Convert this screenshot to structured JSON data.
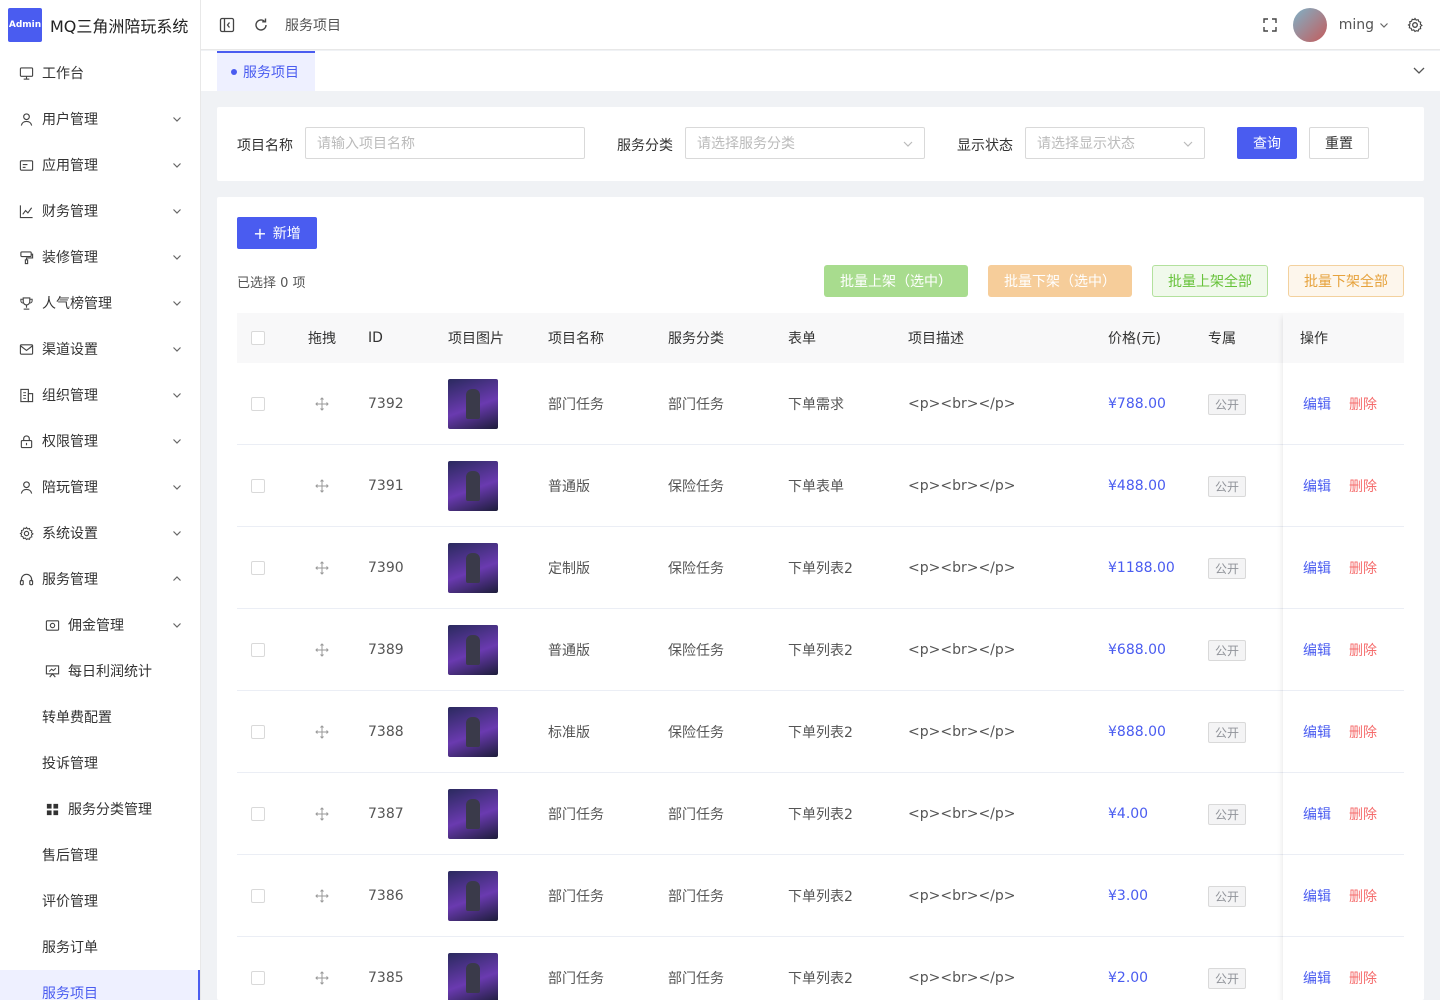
{
  "brand": {
    "logo_text": "Admin",
    "title": "MQ三角洲陪玩系统"
  },
  "sidebar": {
    "items": [
      {
        "label": "工作台",
        "icon": "monitor-icon",
        "arrow": ""
      },
      {
        "label": "用户管理",
        "icon": "user-icon",
        "arrow": "down"
      },
      {
        "label": "应用管理",
        "icon": "app-icon",
        "arrow": "down"
      },
      {
        "label": "财务管理",
        "icon": "chart-icon",
        "arrow": "down"
      },
      {
        "label": "装修管理",
        "icon": "paint-icon",
        "arrow": "down"
      },
      {
        "label": "人气榜管理",
        "icon": "trophy-icon",
        "arrow": "down"
      },
      {
        "label": "渠道设置",
        "icon": "mail-icon",
        "arrow": "down"
      },
      {
        "label": "组织管理",
        "icon": "building-icon",
        "arrow": "down"
      },
      {
        "label": "权限管理",
        "icon": "lock-icon",
        "arrow": "down"
      },
      {
        "label": "陪玩管理",
        "icon": "person-icon",
        "arrow": "down"
      },
      {
        "label": "系统设置",
        "icon": "gear-icon",
        "arrow": "down"
      },
      {
        "label": "服务管理",
        "icon": "headset-icon",
        "arrow": "up"
      }
    ],
    "sub_items": [
      {
        "label": "佣金管理",
        "icon": "wallet-icon",
        "arrow": "down"
      },
      {
        "label": "每日利润统计",
        "icon": "presentation-icon",
        "arrow": ""
      },
      {
        "label": "转单费配置",
        "icon": "",
        "arrow": ""
      },
      {
        "label": "投诉管理",
        "icon": "",
        "arrow": ""
      },
      {
        "label": "服务分类管理",
        "icon": "grid-icon",
        "arrow": ""
      },
      {
        "label": "售后管理",
        "icon": "",
        "arrow": ""
      },
      {
        "label": "评价管理",
        "icon": "",
        "arrow": ""
      },
      {
        "label": "服务订单",
        "icon": "",
        "arrow": ""
      },
      {
        "label": "服务项目",
        "icon": "",
        "arrow": "",
        "active": true
      }
    ]
  },
  "header": {
    "breadcrumb": "服务项目",
    "username": "ming"
  },
  "tabs": [
    {
      "label": "服务项目",
      "active": true
    }
  ],
  "filter": {
    "name_label": "项目名称",
    "name_placeholder": "请输入项目名称",
    "category_label": "服务分类",
    "category_placeholder": "请选择服务分类",
    "status_label": "显示状态",
    "status_placeholder": "请选择显示状态",
    "query_button": "查询",
    "reset_button": "重置"
  },
  "toolbar": {
    "add_button": "新增",
    "selected_text": "已选择 0 项",
    "batch_on_selected": "批量上架（选中）",
    "batch_off_selected": "批量下架（选中）",
    "batch_on_all": "批量上架全部",
    "batch_off_all": "批量下架全部"
  },
  "table": {
    "columns": [
      "拖拽",
      "ID",
      "项目图片",
      "项目名称",
      "服务分类",
      "表单",
      "项目描述",
      "价格(元)",
      "专属",
      "操作"
    ],
    "rows": [
      {
        "id": "7392",
        "name": "部门任务",
        "category": "部门任务",
        "form": "下单需求",
        "desc": "<p><br></p>",
        "price": "¥788.00",
        "exclusive": "公开"
      },
      {
        "id": "7391",
        "name": "普通版",
        "category": "保险任务",
        "form": "下单表单",
        "desc": "<p><br></p>",
        "price": "¥488.00",
        "exclusive": "公开"
      },
      {
        "id": "7390",
        "name": "定制版",
        "category": "保险任务",
        "form": "下单列表2",
        "desc": "<p><br></p>",
        "price": "¥1188.00",
        "exclusive": "公开"
      },
      {
        "id": "7389",
        "name": "普通版",
        "category": "保险任务",
        "form": "下单列表2",
        "desc": "<p><br></p>",
        "price": "¥688.00",
        "exclusive": "公开"
      },
      {
        "id": "7388",
        "name": "标准版",
        "category": "保险任务",
        "form": "下单列表2",
        "desc": "<p><br></p>",
        "price": "¥888.00",
        "exclusive": "公开"
      },
      {
        "id": "7387",
        "name": "部门任务",
        "category": "部门任务",
        "form": "下单列表2",
        "desc": "<p><br></p>",
        "price": "¥4.00",
        "exclusive": "公开"
      },
      {
        "id": "7386",
        "name": "部门任务",
        "category": "部门任务",
        "form": "下单列表2",
        "desc": "<p><br></p>",
        "price": "¥3.00",
        "exclusive": "公开"
      },
      {
        "id": "7385",
        "name": "部门任务",
        "category": "部门任务",
        "form": "下单列表2",
        "desc": "<p><br></p>",
        "price": "¥2.00",
        "exclusive": "公开"
      }
    ],
    "edit_label": "编辑",
    "delete_label": "删除"
  },
  "colors": {
    "primary": "#4a5cf0",
    "danger": "#f56c6c",
    "success": "#67c23a",
    "warning": "#e6a23c"
  }
}
